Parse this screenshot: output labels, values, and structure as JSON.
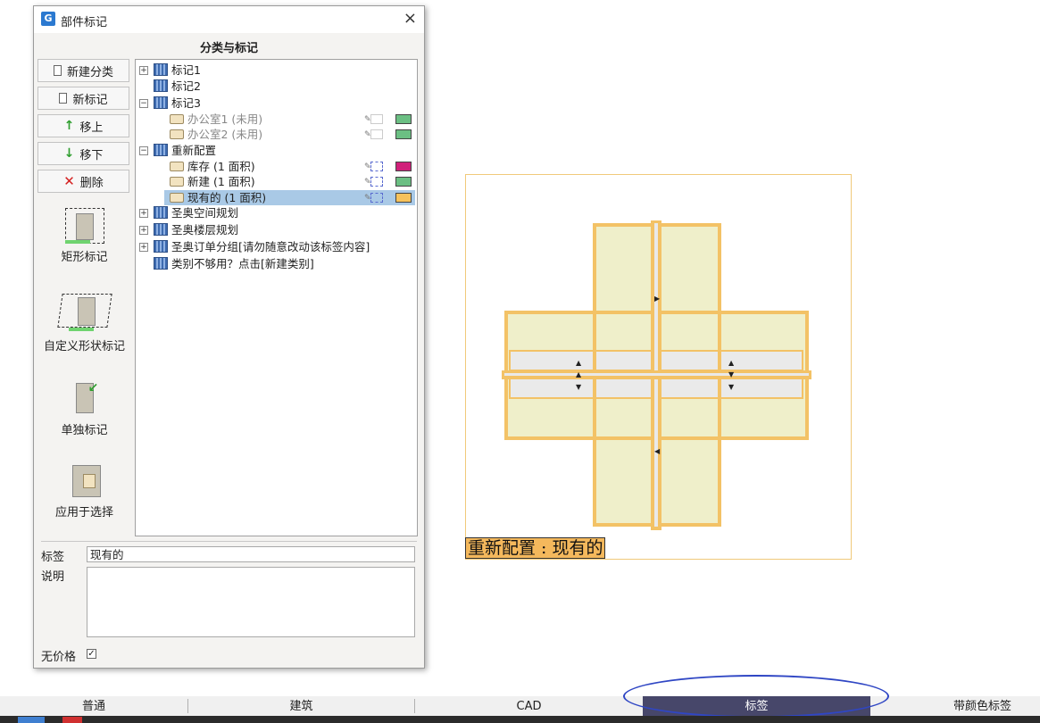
{
  "dialog": {
    "title": "部件标记",
    "close_glyph": "×",
    "section_title": "分类与标记",
    "buttons": {
      "new_category": "新建分类",
      "new_tag": "新标记",
      "move_up": "移上",
      "move_down": "移下",
      "delete": "删除"
    },
    "tools": {
      "rect_tag": "矩形标记",
      "custom_shape_tag": "自定义形状标记",
      "single_tag": "单独标记",
      "apply_to_selection": "应用于选择"
    },
    "tree": [
      {
        "label": "标记1",
        "type": "category",
        "expander": "+"
      },
      {
        "label": "标记2",
        "type": "category",
        "expander": ""
      },
      {
        "label": "标记3",
        "type": "category",
        "expander": "−"
      },
      {
        "label": "办公室1 (未用)",
        "type": "tag",
        "unused": true,
        "color": "#6bbf83"
      },
      {
        "label": "办公室2 (未用)",
        "type": "tag",
        "unused": true,
        "color": "#6bbf83"
      },
      {
        "label": "重新配置",
        "type": "category",
        "expander": "−"
      },
      {
        "label": "库存 (1 面积)",
        "type": "tag",
        "unused": false,
        "color": "#d0207a"
      },
      {
        "label": "新建 (1 面积)",
        "type": "tag",
        "unused": false,
        "color": "#6bbf83"
      },
      {
        "label": "现有的 (1 面积)",
        "type": "tag",
        "unused": false,
        "color": "#f6c25c",
        "selected": true
      },
      {
        "label": "圣奥空间规划",
        "type": "category",
        "expander": "+"
      },
      {
        "label": "圣奥楼层规划",
        "type": "category",
        "expander": "+"
      },
      {
        "label": "圣奥订单分组[请勿随意改动该标签内容]",
        "type": "category",
        "expander": "+"
      },
      {
        "label": "类别不够用？点击[新建类别]",
        "type": "category",
        "expander": ""
      }
    ],
    "fields": {
      "tag_label": "标签",
      "tag_value": "现有的",
      "desc_label": "说明",
      "desc_value": "",
      "no_price_label": "无价格",
      "no_price_checked": "✓"
    }
  },
  "canvas": {
    "caption": "重新配置 : 现有的",
    "fill_color": "#efefca",
    "edge_color": "#f3c266"
  },
  "tabs": [
    {
      "label": "普通"
    },
    {
      "label": "建筑"
    },
    {
      "label": "CAD"
    },
    {
      "label": "标签",
      "active": true
    },
    {
      "label": "带颜色标签"
    }
  ],
  "colors": {
    "highlight_ellipse": "#2f46c4",
    "active_tab": "#47476a"
  }
}
